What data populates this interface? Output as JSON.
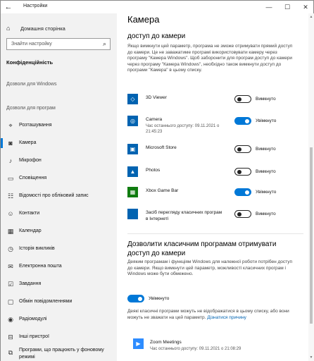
{
  "window": {
    "title": "Настройки",
    "back_icon": "back-arrow-icon",
    "min_icon": "minimize-icon",
    "max_icon": "maximize-icon",
    "close_icon": "close-icon"
  },
  "sidebar": {
    "home": "Домашня сторінка",
    "search_placeholder": "Знайти настройку",
    "section": "Конфіденційність",
    "group_windows": "Дозволи для Windows",
    "group_apps": "Дозволи для програм",
    "items": [
      {
        "label": "Розташування",
        "icon": "location-icon"
      },
      {
        "label": "Камера",
        "icon": "camera-icon",
        "active": true
      },
      {
        "label": "Мікрофон",
        "icon": "microphone-icon"
      },
      {
        "label": "Сповіщення",
        "icon": "notifications-icon"
      },
      {
        "label": "Відомості про обліковий запис",
        "icon": "account-info-icon"
      },
      {
        "label": "Контакти",
        "icon": "contacts-icon"
      },
      {
        "label": "Календар",
        "icon": "calendar-icon"
      },
      {
        "label": "Історія викликів",
        "icon": "call-history-icon"
      },
      {
        "label": "Електронна пошта",
        "icon": "email-icon"
      },
      {
        "label": "Завдання",
        "icon": "tasks-icon"
      },
      {
        "label": "Обмін повідомленнями",
        "icon": "messaging-icon"
      },
      {
        "label": "Радіомодулі",
        "icon": "radios-icon"
      },
      {
        "label": "Інші пристрої",
        "icon": "other-devices-icon"
      },
      {
        "label": "Програми, що працюють у фоновому режимі",
        "icon": "background-apps-icon"
      }
    ]
  },
  "main": {
    "title": "Камера",
    "section1_title": "доступ до камери",
    "section1_desc": "Якщо вимкнути цей параметр, програма не зможе отримувати прямий доступ до камери. Це не заважатиме програмі використовувати камеру через програму \"Камера Windows\". Щоб заборонити для програм доступ до камери через програму \"Камера Windows\", необхідно також вимкнути доступ до програми \"Камера\" в цьому списку.",
    "apps": [
      {
        "name": "3D Viewer",
        "sub": "",
        "state": "Вимкнуто",
        "on": false,
        "icon": "3d-viewer-icon"
      },
      {
        "name": "Camera",
        "sub": "Час останнього доступу: 09.11.2021 о 21:45:23",
        "state": "Увімкнуто",
        "on": true,
        "icon": "camera-app-icon"
      },
      {
        "name": "Microsoft Store",
        "sub": "",
        "state": "Вимкнуто",
        "on": false,
        "icon": "store-icon"
      },
      {
        "name": "Photos",
        "sub": "",
        "state": "Вимкнуто",
        "on": false,
        "icon": "photos-icon"
      },
      {
        "name": "Xbox Game Bar",
        "sub": "",
        "state": "Увімкнуто",
        "on": true,
        "icon": "xbox-icon"
      },
      {
        "name": "Засіб перегляду класичних програм в Інтернеті",
        "sub": "",
        "state": "Вимкнуто",
        "on": false,
        "icon": "web-viewer-icon"
      }
    ],
    "section2_title": "Дозволити класичним програмам отримувати доступ до камери",
    "section2_desc": "Деяким програмам і функціям Windows для належної роботи потрібен доступ до камери. Якщо вимкнути цей параметр, можливості класичних програм і Windows може бути обмежено.",
    "master_state": "Увімкнуто",
    "note_text": "Деякі класичні програми можуть не відображатися в цьому списку, або вони можуть не зважати на цей параметр.",
    "note_link": "Дізнатися причину",
    "zoom": {
      "name": "Zoom Meetings",
      "sub": "Час останнього доступу: 09.11.2021 о 21:08:29",
      "icon": "zoom-icon"
    },
    "colors": {
      "accent": "#0078d7",
      "sidebar_bg": "#f2f2f2"
    }
  }
}
